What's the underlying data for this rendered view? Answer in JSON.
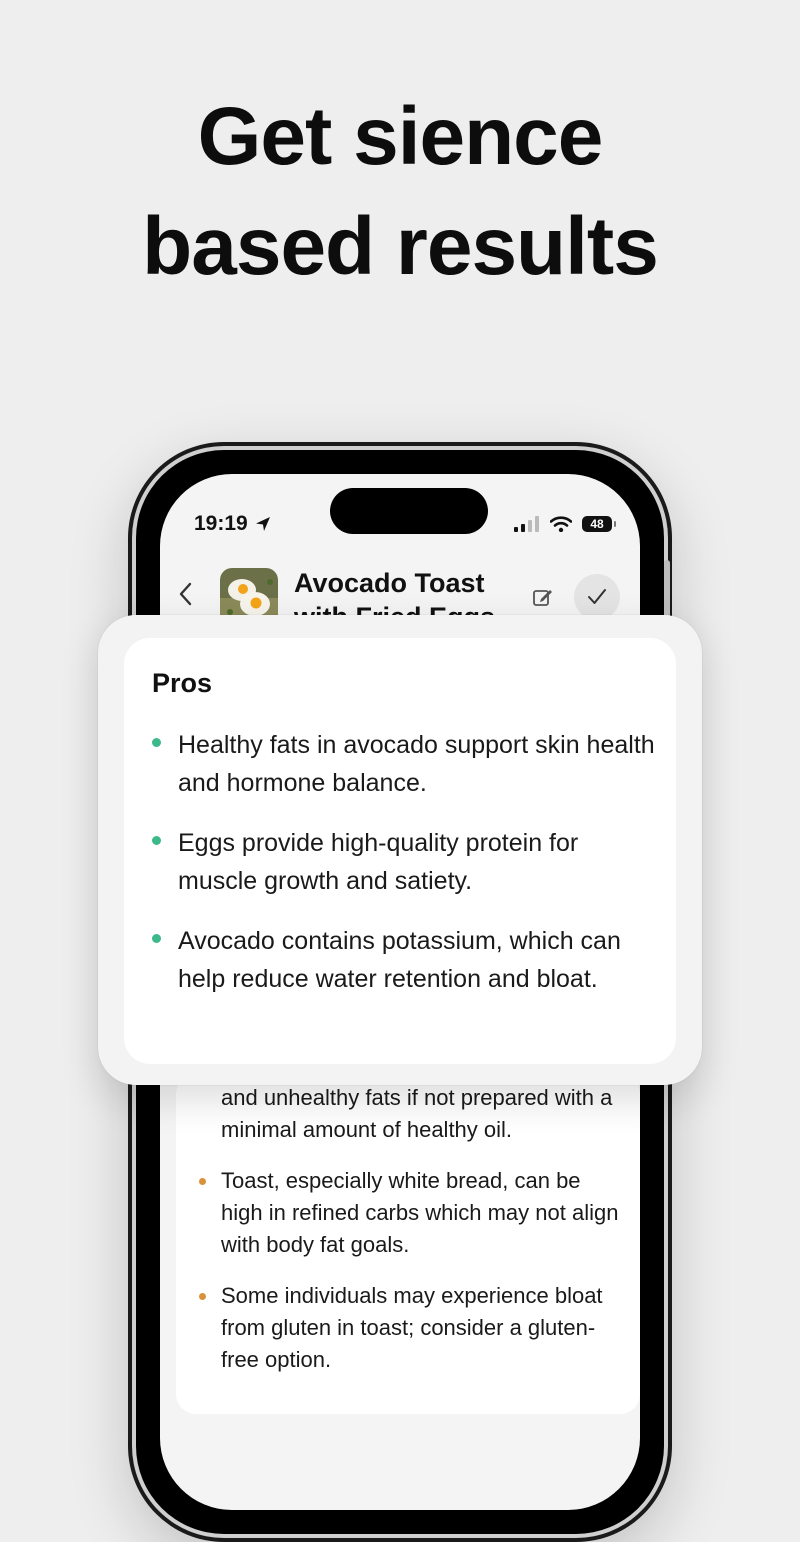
{
  "headline": {
    "line1": "Get sience",
    "line2": "based results"
  },
  "status_bar": {
    "time": "19:19",
    "battery": "48",
    "icons": [
      "location-arrow-icon",
      "cellular-signal-icon",
      "wifi-icon",
      "battery-icon"
    ]
  },
  "nav": {
    "back_icon": "chevron-left-icon",
    "title_line1": "Avocado Toast",
    "title_line2": "with Fried Eggs",
    "edit_icon": "edit-icon",
    "confirm_icon": "checkmark-icon"
  },
  "pros": {
    "title": "Pros",
    "bullet_color": "#3cb98a",
    "items": [
      "Healthy fats in avocado support skin health and hormone balance.",
      "Eggs provide high-quality protein for muscle growth and satiety.",
      "Avocado contains potassium, which can help reduce water retention and bloat."
    ]
  },
  "cons": {
    "bullet_color": "#d9913a",
    "partial_item": "and unhealthy fats if not prepared with a minimal amount of healthy oil.",
    "items": [
      "Toast, especially white bread, can be high in refined carbs which may not align with body fat goals.",
      "Some individuals may experience bloat from gluten in toast; consider a gluten-free option."
    ]
  }
}
